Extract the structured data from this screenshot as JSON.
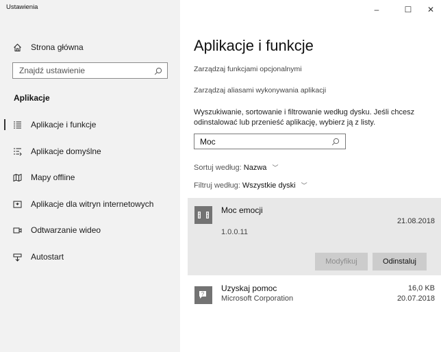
{
  "window": {
    "title": "Ustawienia",
    "controls": {
      "minimize": "–",
      "maximize": "☐",
      "close": "✕"
    }
  },
  "sidebar": {
    "home_label": "Strona główna",
    "search_placeholder": "Znajdź ustawienie",
    "section_title": "Aplikacje",
    "items": [
      {
        "label": "Aplikacje i funkcje",
        "icon": "apps-list-icon",
        "active": true
      },
      {
        "label": "Aplikacje domyślne",
        "icon": "default-apps-icon"
      },
      {
        "label": "Mapy offline",
        "icon": "map-icon"
      },
      {
        "label": "Aplikacje dla witryn internetowych",
        "icon": "web-apps-icon"
      },
      {
        "label": "Odtwarzanie wideo",
        "icon": "video-icon"
      },
      {
        "label": "Autostart",
        "icon": "startup-icon"
      }
    ]
  },
  "main": {
    "title": "Aplikacje i funkcje",
    "links": [
      "Zarządzaj funkcjami opcjonalnymi",
      "Zarządzaj aliasami wykonywania aplikacji"
    ],
    "description": "Wyszukiwanie, sortowanie i filtrowanie według dysku. Jeśli chcesz odinstalować lub przenieść aplikację, wybierz ją z listy.",
    "search_value": "Moc",
    "sort": {
      "label": "Sortuj według:",
      "value": "Nazwa"
    },
    "filter": {
      "label": "Filtruj według:",
      "value": "Wszystkie dyski"
    },
    "apps": [
      {
        "name": "Moc emocji",
        "version": "1.0.0.11",
        "date": "21.08.2018",
        "selected": true,
        "buttons": {
          "modify": "Modyfikuj",
          "uninstall": "Odinstaluj"
        }
      },
      {
        "name": "Uzyskaj pomoc",
        "publisher": "Microsoft Corporation",
        "size": "16,0 KB",
        "date": "20.07.2018"
      }
    ]
  },
  "colors": {
    "sidebar_bg": "#f2f2f2",
    "selected_bg": "#e8e8e8",
    "icon_gray": "#737373"
  }
}
